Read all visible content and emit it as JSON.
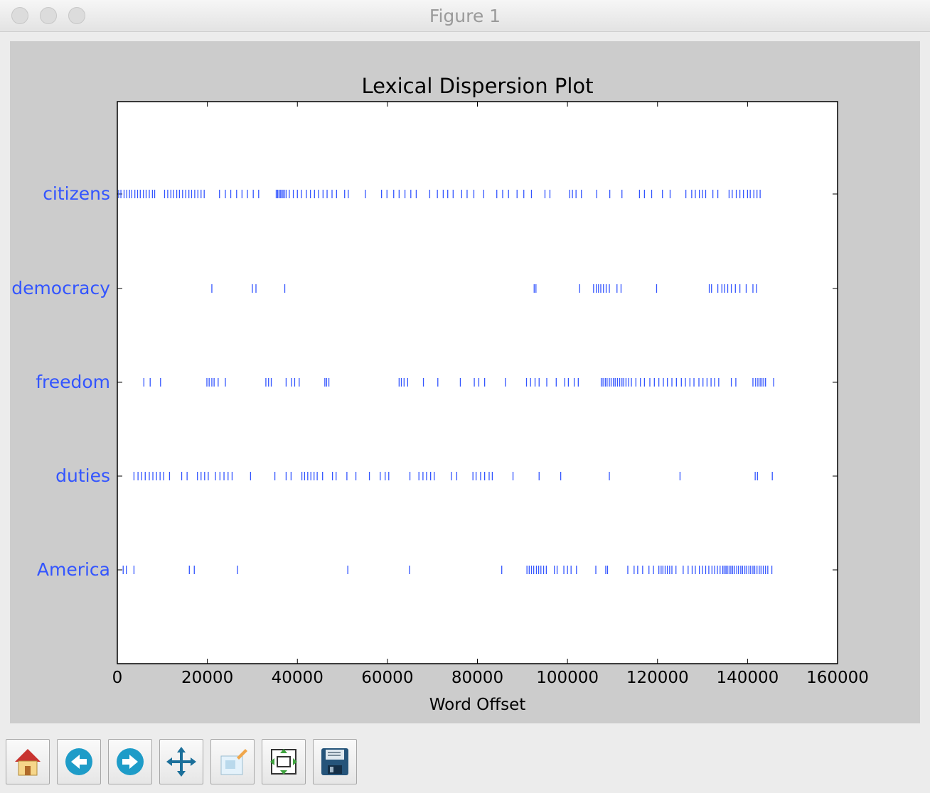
{
  "window": {
    "title": "Figure 1"
  },
  "toolbar": {
    "buttons": [
      {
        "name": "home-button",
        "icon": "home-icon"
      },
      {
        "name": "back-button",
        "icon": "back-arrow-icon"
      },
      {
        "name": "forward-button",
        "icon": "forward-arrow-icon"
      },
      {
        "name": "pan-button",
        "icon": "move-icon"
      },
      {
        "name": "zoom-button",
        "icon": "zoom-rect-icon"
      },
      {
        "name": "subplots-button",
        "icon": "subplots-icon"
      },
      {
        "name": "save-button",
        "icon": "floppy-disk-icon"
      }
    ]
  },
  "chart_data": {
    "type": "scatter",
    "title": "Lexical Dispersion Plot",
    "xlabel": "Word Offset",
    "ylabel": "",
    "xlim": [
      0,
      160000
    ],
    "xticks": [
      0,
      20000,
      40000,
      60000,
      80000,
      100000,
      120000,
      140000,
      160000
    ],
    "grid": false,
    "marker": "|",
    "color": "#3355ff",
    "series": [
      {
        "name": "citizens",
        "values": [
          300,
          800,
          1500,
          2100,
          2700,
          3200,
          3900,
          4500,
          5100,
          5800,
          6400,
          7100,
          7800,
          8300,
          10500,
          11200,
          11900,
          12500,
          13200,
          13800,
          14500,
          15200,
          15900,
          16500,
          17200,
          17900,
          18600,
          19300,
          22700,
          24000,
          25200,
          26500,
          27700,
          28900,
          30200,
          31400,
          35300,
          35600,
          35900,
          36200,
          36500,
          36800,
          37100,
          37500,
          38200,
          39100,
          40000,
          40900,
          42000,
          42900,
          43800,
          44700,
          45700,
          46600,
          47700,
          48700,
          50500,
          51300,
          55100,
          58700,
          59900,
          61400,
          62600,
          63900,
          65200,
          66400,
          69400,
          71100,
          72400,
          73400,
          74600,
          76500,
          77700,
          79200,
          81400,
          84300,
          85600,
          86900,
          88800,
          90300,
          92000,
          95000,
          96100,
          100500,
          101100,
          101900,
          103100,
          106500,
          109400,
          112100,
          116000,
          117100,
          118700,
          121100,
          122800,
          126300,
          127600,
          128400,
          129300,
          130000,
          130700,
          132300,
          133400,
          135900,
          136600,
          137500,
          138300,
          139100,
          140000,
          140600,
          141400,
          142100,
          142800
        ]
      },
      {
        "name": "democracy",
        "values": [
          21000,
          30000,
          30800,
          37200,
          92600,
          93000,
          102700,
          105800,
          106400,
          106900,
          107400,
          108000,
          108600,
          109300,
          111000,
          111900,
          119800,
          131500,
          132000,
          133400,
          134300,
          134900,
          135600,
          136400,
          137300,
          138300,
          139700,
          141200,
          142000
        ]
      },
      {
        "name": "freedom",
        "values": [
          5900,
          7300,
          9600,
          19900,
          20400,
          21000,
          21500,
          22400,
          24000,
          33000,
          33600,
          34200,
          37500,
          38700,
          39400,
          40400,
          46100,
          46500,
          47000,
          62600,
          63100,
          63700,
          64500,
          68000,
          71200,
          76200,
          79300,
          80300,
          81600,
          86200,
          90900,
          91800,
          92800,
          93700,
          95400,
          97500,
          99400,
          100200,
          101500,
          102400,
          107500,
          107900,
          108400,
          108800,
          109300,
          109700,
          110200,
          110600,
          111100,
          111600,
          112100,
          112500,
          113000,
          113600,
          114200,
          115200,
          116200,
          117100,
          118300,
          119300,
          120300,
          121300,
          122200,
          123200,
          124200,
          125300,
          126200,
          127200,
          128100,
          129200,
          130100,
          131000,
          131900,
          132700,
          133600,
          136400,
          137400,
          141200,
          141800,
          142300,
          142800,
          143200,
          143600,
          144000,
          145800
        ]
      },
      {
        "name": "duties",
        "values": [
          3700,
          4600,
          5400,
          6200,
          7100,
          7900,
          8700,
          9500,
          10300,
          11600,
          14300,
          15500,
          17800,
          18600,
          19400,
          20200,
          21800,
          22800,
          23700,
          24600,
          25500,
          29600,
          35000,
          37500,
          38600,
          41000,
          41600,
          42300,
          43000,
          43700,
          44400,
          45600,
          47800,
          48600,
          51000,
          53000,
          56000,
          58400,
          59500,
          60300,
          65000,
          67000,
          67900,
          68700,
          69600,
          70400,
          74200,
          75400,
          79000,
          79700,
          80700,
          81600,
          82600,
          83300,
          87900,
          93700,
          98500,
          109300,
          125000,
          141700,
          142200,
          145500
        ]
      },
      {
        "name": "America",
        "values": [
          1300,
          2000,
          3700,
          16000,
          17100,
          26700,
          51200,
          64900,
          85400,
          91000,
          91500,
          92000,
          92500,
          93100,
          93600,
          94100,
          94700,
          95300,
          97100,
          97700,
          99200,
          100000,
          100800,
          102000,
          106300,
          108500,
          108900,
          113400,
          114800,
          115600,
          116700,
          118100,
          119100,
          120300,
          120800,
          121200,
          121700,
          122200,
          122700,
          123200,
          124100,
          125700,
          126800,
          127700,
          128400,
          129300,
          130000,
          130700,
          131400,
          132100,
          132700,
          133300,
          133900,
          134500,
          134800,
          135200,
          135500,
          135900,
          136300,
          136700,
          137100,
          137600,
          138000,
          138500,
          138900,
          139400,
          139800,
          140300,
          140700,
          141200,
          141600,
          142100,
          142600,
          143000,
          143500,
          144000,
          144500,
          145400
        ]
      }
    ]
  }
}
